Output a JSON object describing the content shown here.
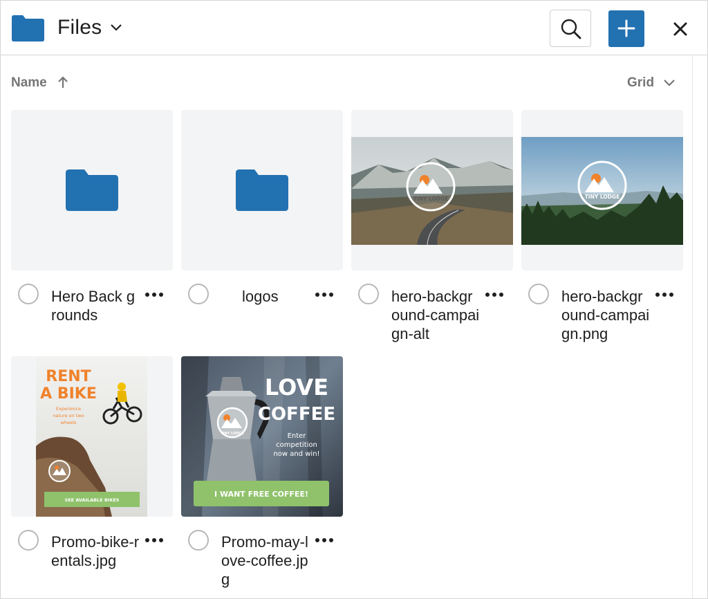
{
  "header": {
    "title": "Files",
    "icons": {
      "folder": "folder-icon",
      "chevron": "chevron-down-icon",
      "search": "search-icon",
      "add": "plus-icon",
      "close": "close-icon"
    }
  },
  "toolbar": {
    "sort_label": "Name",
    "sort_direction": "ascending",
    "view_label": "Grid"
  },
  "colors": {
    "accent": "#2271b1",
    "tile_bg": "#f3f4f5",
    "muted_text": "#757575"
  },
  "items": [
    {
      "type": "folder",
      "name": "Hero Back grounds"
    },
    {
      "type": "folder",
      "name": "logos"
    },
    {
      "type": "image",
      "name": "hero-background-campaign-alt",
      "thumbnail": "mountain road with Tiny Lodge logo",
      "logo_text": "TINY LODGE"
    },
    {
      "type": "image",
      "name": "hero-background-campaign.png",
      "thumbnail": "forest valley with Tiny Lodge logo",
      "logo_text": "TINY LODGE"
    },
    {
      "type": "image",
      "name": "Promo-bike-rentals.jpg",
      "thumbnail": "bike rental poster",
      "poster_title_1": "RENT",
      "poster_title_2": "A BIKE",
      "poster_sub_1": "Experience",
      "poster_sub_2": "nature on two",
      "poster_sub_3": "wheels",
      "poster_button": "SEE AVAILABLE BIKES"
    },
    {
      "type": "image",
      "name": "Promo-may-love-coffee.jpg",
      "thumbnail": "coffee promo poster",
      "poster_title_1": "LOVE",
      "poster_title_2": "COFFEE",
      "poster_sub_1": "Enter",
      "poster_sub_2": "competition",
      "poster_sub_3": "now and win!",
      "poster_button": "I WANT FREE COFFEE!",
      "logo_text": "TINY LODGE"
    }
  ]
}
